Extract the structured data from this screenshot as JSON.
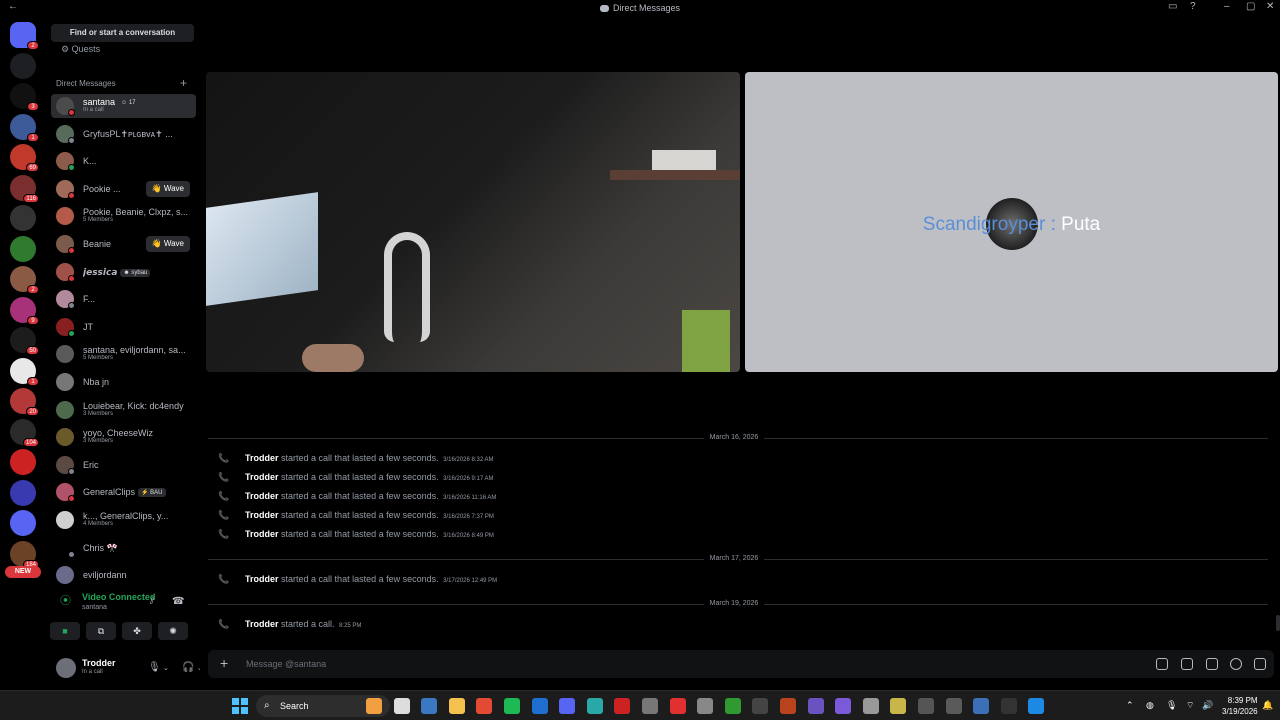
{
  "window": {
    "title": "Direct Messages"
  },
  "guilds": [
    {
      "color": "#5865f2",
      "badge": "2"
    },
    {
      "color": "#1e1f22",
      "badge": ""
    },
    {
      "color": "#111111",
      "badge": "3"
    },
    {
      "color": "#3d5a99",
      "badge": "1"
    },
    {
      "color": "#c0392b",
      "badge": "69"
    },
    {
      "color": "#7a2e2e",
      "badge": "116"
    },
    {
      "color": "#333333",
      "badge": ""
    },
    {
      "color": "#2f7a2f",
      "badge": ""
    },
    {
      "color": "#8a5a44",
      "badge": "2"
    },
    {
      "color": "#a83279",
      "badge": "9"
    },
    {
      "color": "#1c1c1c",
      "badge": "50"
    },
    {
      "color": "#e8e8e8",
      "badge": "1"
    },
    {
      "color": "#b33939",
      "badge": "20"
    },
    {
      "color": "#2a2a2a",
      "badge": "104"
    },
    {
      "color": "#cc2222",
      "badge": ""
    },
    {
      "color": "#3a3ab0",
      "badge": ""
    },
    {
      "color": "#5865f2",
      "badge": ""
    },
    {
      "color": "#6b4226",
      "badge": "184"
    }
  ],
  "new_pill": "NEW",
  "sidebar": {
    "find": "Find or start a conversation",
    "quests": "Quests",
    "dm_header": "Direct Messages",
    "dms": [
      {
        "name": "santana",
        "tag": "☺ 17",
        "sub": "In a call",
        "color": "#4b4b4b",
        "status": "#da373c",
        "active": true
      },
      {
        "name": "GryfusPL✝ᴘʟɢʙᴠᴀ✝ ...",
        "sub": "",
        "color": "#566b5a",
        "status": "#80848e"
      },
      {
        "name": "K...",
        "sub": "",
        "color": "#8d5b4c",
        "status": "#23a559"
      },
      {
        "name": "Pookie ...",
        "sub": "",
        "color": "#a06a5a",
        "status": "#da373c",
        "wave": "👋 Wave"
      },
      {
        "name": "Pookie, Beanie, Clxpz, s...",
        "sub": "5 Members",
        "color": "#b35a4a",
        "status": ""
      },
      {
        "name": "Beanie",
        "sub": "",
        "color": "#7c5a4c",
        "status": "#da373c",
        "wave": "👋 Wave"
      },
      {
        "name": "𝙟𝙚𝙨𝙨𝙞𝙘𝙖",
        "tag": "☻ sybau",
        "sub": "",
        "color": "#a0524a",
        "status": "#da373c"
      },
      {
        "name": "F...",
        "sub": "",
        "color": "#b3899c",
        "status": "#80848e"
      },
      {
        "name": "JT",
        "sub": "",
        "color": "#8a1f1f",
        "status": "#23a559"
      },
      {
        "name": "santana, eviljordann, sa...",
        "sub": "5 Members",
        "color": "#5a5a5a",
        "status": ""
      },
      {
        "name": "Nba jn",
        "sub": "",
        "color": "#777777",
        "status": ""
      },
      {
        "name": "Louiebear, Kick: dc4endy",
        "sub": "3 Members",
        "color": "#4d6a4d",
        "status": ""
      },
      {
        "name": "yoyo, CheeseWiz",
        "sub": "3 Members",
        "color": "#6a5a2a",
        "status": ""
      },
      {
        "name": "Eric",
        "sub": "",
        "color": "#5b4a42",
        "status": "#80848e"
      },
      {
        "name": "GeneralClips",
        "tag": "⚡ BAU",
        "sub": "",
        "color": "#b0526a",
        "status": "#da373c"
      },
      {
        "name": "k..., GeneralClips, y...",
        "sub": "4 Members",
        "color": "#cfcfcf",
        "status": ""
      },
      {
        "name": "Chris 🎌",
        "sub": "",
        "color": "#000000",
        "status": "#80848e"
      },
      {
        "name": "eviljordann",
        "sub": "",
        "color": "#6a6a8a",
        "status": ""
      }
    ],
    "voice": {
      "title": "Video Connected",
      "sub": "santana"
    },
    "user": {
      "name": "Trodder",
      "sub": "In a call"
    }
  },
  "call": {
    "speaker_name": "Scandigroyper",
    "speaker_sep": " : ",
    "speaker_msg": "Puta"
  },
  "dates": [
    "March 16, 2026",
    "March 17, 2026",
    "March 19, 2026"
  ],
  "calls": [
    {
      "who": "Trodder",
      "text": "started a call that lasted a few seconds.",
      "ts": "3/16/2026 8:32 AM"
    },
    {
      "who": "Trodder",
      "text": "started a call that lasted a few seconds.",
      "ts": "3/16/2026 9:17 AM"
    },
    {
      "who": "Trodder",
      "text": "started a call that lasted a few seconds.",
      "ts": "3/16/2026 11:16 AM"
    },
    {
      "who": "Trodder",
      "text": "started a call that lasted a few seconds.",
      "ts": "3/16/2026 7:37 PM"
    },
    {
      "who": "Trodder",
      "text": "started a call that lasted a few seconds.",
      "ts": "3/16/2026 8:49 PM"
    },
    {
      "who": "Trodder",
      "text": "started a call that lasted a few seconds.",
      "ts": "3/17/2026 12:49 PM"
    },
    {
      "who": "Trodder",
      "text": "started a call.",
      "ts": "8:25 PM"
    }
  ],
  "composer": {
    "placeholder": "Message @santana"
  },
  "taskbar": {
    "search": "Search",
    "apps": [
      "#f0a040",
      "#dddddd",
      "#3a78c4",
      "#f2c14e",
      "#e24a33",
      "#1db954",
      "#1f6fd1",
      "#5865f2",
      "#2aa7a7",
      "#cc2222",
      "#777777",
      "#e03030",
      "#888888",
      "#2f9a2f",
      "#444444",
      "#b9431d",
      "#6a52c0",
      "#7a5ad8",
      "#999999",
      "#c8b64a",
      "#555555",
      "#5a5a5a",
      "#3b6fb6",
      "#333333",
      "#1e88e5"
    ],
    "time": "8:39 PM",
    "date": "3/19/2026"
  }
}
